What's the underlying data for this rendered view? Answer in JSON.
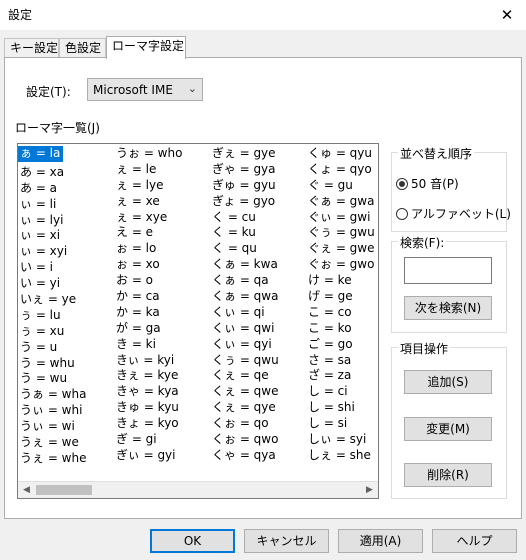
{
  "window": {
    "title": "設定",
    "close_glyph": "✕"
  },
  "tabs": [
    {
      "label": "キー設定"
    },
    {
      "label": "色設定"
    },
    {
      "label": "ローマ字設定"
    }
  ],
  "settings": {
    "label": "設定(T):",
    "selected": "Microsoft IME",
    "arrow": "⌄"
  },
  "list": {
    "label": "ローマ字一覧(J)",
    "columns": [
      [
        "ぁ = la",
        "あ = xa",
        "あ = a",
        "ぃ = li",
        "ぃ = lyi",
        "ぃ = xi",
        "ぃ = xyi",
        "い = i",
        "い = yi",
        "いぇ = ye",
        "ぅ = lu",
        "ぅ = xu",
        "う = u",
        "う = whu",
        "う = wu",
        "うぁ = wha",
        "うぃ = whi",
        "うぃ = wi",
        "うぇ = we",
        "うぇ = whe"
      ],
      [
        "うぉ = who",
        "ぇ = le",
        "ぇ = lye",
        "ぇ = xe",
        "ぇ = xye",
        "え = e",
        "ぉ = lo",
        "ぉ = xo",
        "お = o",
        "か = ca",
        "か = ka",
        "が = ga",
        "き = ki",
        "きぃ = kyi",
        "きぇ = kye",
        "きゃ = kya",
        "きゅ = kyu",
        "きょ = kyo",
        "ぎ = gi",
        "ぎぃ = gyi"
      ],
      [
        "ぎぇ = gye",
        "ぎゃ = gya",
        "ぎゅ = gyu",
        "ぎょ = gyo",
        "く = cu",
        "く = ku",
        "く = qu",
        "くぁ = kwa",
        "くぁ = qa",
        "くぁ = qwa",
        "くぃ = qi",
        "くぃ = qwi",
        "くぃ = qyi",
        "くぅ = qwu",
        "くぇ = qe",
        "くぇ = qwe",
        "くぇ = qye",
        "くぉ = qo",
        "くぉ = qwo",
        "くゃ = qya"
      ],
      [
        "くゅ = qyu",
        "くょ = qyo",
        "ぐ = gu",
        "ぐぁ = gwa",
        "ぐぃ = gwi",
        "ぐぅ = gwu",
        "ぐぇ = gwe",
        "ぐぉ = gwo",
        "け = ke",
        "げ = ge",
        "こ = co",
        "こ = ko",
        "ご = go",
        "さ = sa",
        "ざ = za",
        "し = ci",
        "し = shi",
        "し = si",
        "しぃ = syi",
        "しぇ = she"
      ]
    ],
    "scroll_left": "◀",
    "scroll_right": "▶"
  },
  "sort": {
    "title": "並べ替え順序",
    "option_gojuon": "50 音(P)",
    "option_alphabet": "アルファベット(L)",
    "selected": "gojuon"
  },
  "search": {
    "title": "検索(F):",
    "value": "",
    "next_button": "次を検索(N)"
  },
  "item_ops": {
    "title": "項目操作",
    "add": "追加(S)",
    "change": "変更(M)",
    "delete": "削除(R)"
  },
  "footer": {
    "ok": "OK",
    "cancel": "キャンセル",
    "apply": "適用(A)",
    "help": "ヘルプ"
  }
}
